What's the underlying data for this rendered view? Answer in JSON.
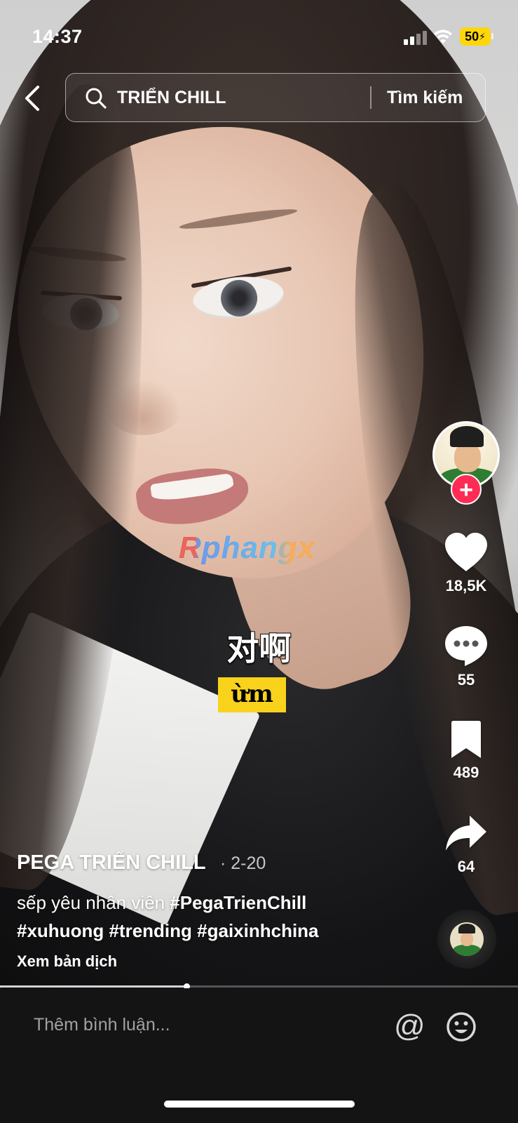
{
  "status_bar": {
    "time": "14:37",
    "battery": "50",
    "signal_bars_active": 2,
    "signal_bars_total": 4
  },
  "search": {
    "query": "TRIỂN CHILL",
    "button_label": "Tìm kiếm"
  },
  "video": {
    "watermark": "Rphangx",
    "subtitle_cn": "对啊",
    "subtitle_vn": "ừm",
    "progress_fraction": 0.36
  },
  "actions": {
    "likes": "18,5K",
    "comments": "55",
    "saves": "489",
    "shares": "64"
  },
  "post": {
    "creator": "PEGA TRIỂN CHILL",
    "date": "· 2-20",
    "caption_text": "sếp yêu nhân viên ",
    "hashtags": [
      "#PegaTrienChill",
      "#xuhuong",
      "#trending",
      "#gaixinhchina"
    ],
    "translate_label": "Xem bản dịch"
  },
  "comment_bar": {
    "placeholder": "Thêm bình luận..."
  },
  "colors": {
    "follow_accent": "#fe2c55",
    "subtitle_highlight": "#f9d21c",
    "battery": "#ffd60a"
  },
  "icons": [
    "back-arrow-icon",
    "search-icon",
    "plus-icon",
    "heart-icon",
    "comment-bubble-icon",
    "bookmark-icon",
    "share-arrow-icon",
    "music-disc-icon",
    "at-sign-icon",
    "emoji-icon",
    "wifi-icon",
    "signal-icon",
    "battery-icon"
  ]
}
